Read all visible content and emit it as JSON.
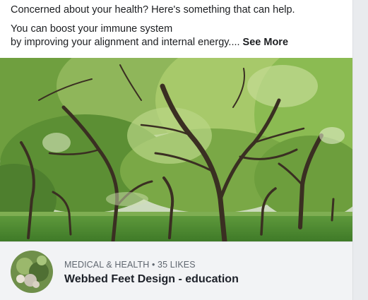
{
  "post": {
    "headline": "Concerned about your health?  Here's something that can help.",
    "body_line1": "You can boost your immune system",
    "body_line2": "by improving your alignment and internal energy....",
    "see_more": "See More"
  },
  "photo": {
    "subject": "park-trees-photo"
  },
  "link": {
    "category": "MEDICAL & HEALTH",
    "separator": "•",
    "likes": "35 LIKES",
    "page_name": "Webbed Feet Design - education"
  }
}
